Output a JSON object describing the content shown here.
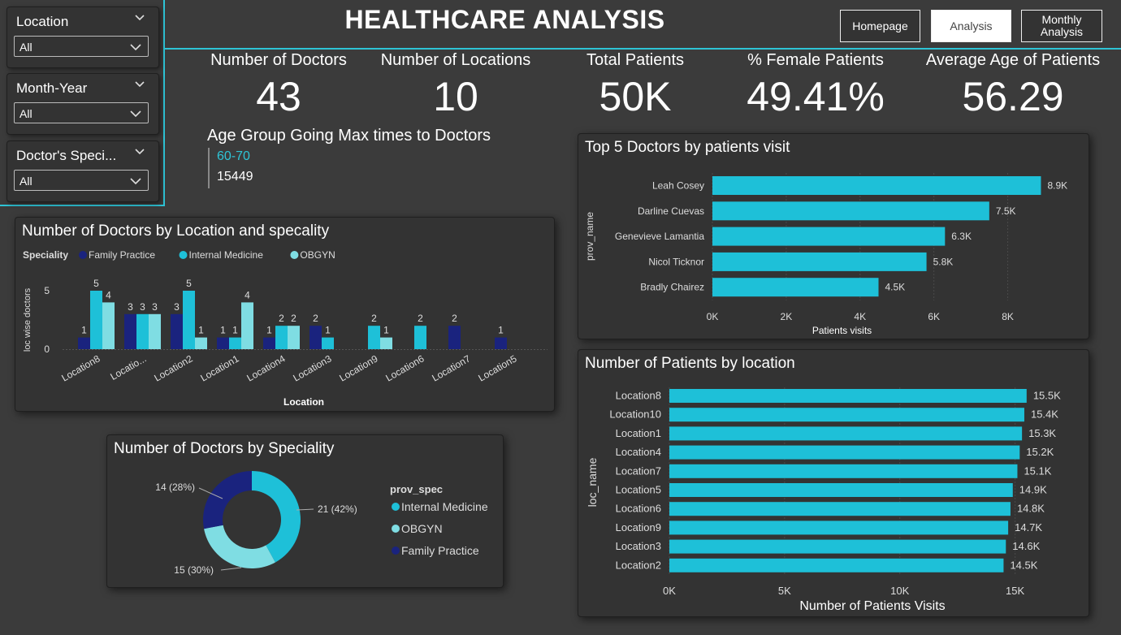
{
  "dashboard_title": "HEALTHCARE ANALYSIS",
  "nav": {
    "homepage": "Homepage",
    "analysis": "Analysis",
    "monthly_line1": "Monthly",
    "monthly_line2": "Analysis"
  },
  "slicers": [
    {
      "title": "Location",
      "value": "All"
    },
    {
      "title": "Month-Year",
      "value": "All"
    },
    {
      "title": "Doctor's Speci...",
      "value": "All"
    }
  ],
  "kpis": [
    {
      "label": "Number of Doctors",
      "value": "43"
    },
    {
      "label": "Number of Locations",
      "value": "10"
    },
    {
      "label": "Total Patients",
      "value": "50K"
    },
    {
      "label": "% Female Patients",
      "value": "49.41%"
    },
    {
      "label": "Average Age of Patients",
      "value": "56.29"
    }
  ],
  "age_group": {
    "title": "Age Group Going Max times to Doctors",
    "category": "60-70",
    "value": "15449"
  },
  "colors": {
    "family_practice": "#1a237e",
    "internal_medicine": "#1ec0d8",
    "obgyn": "#7fdde3",
    "accent": "#2ec4d6"
  },
  "chart_data": [
    {
      "id": "doctors_by_location",
      "type": "bar",
      "title": "Number of Doctors by Location and specality",
      "xlabel": "Location",
      "ylabel": "loc wise doctors",
      "legend_title": "Speciality",
      "legend_position": "top-left",
      "yticks": [
        "0",
        "5"
      ],
      "ylim": [
        0,
        5
      ],
      "categories": [
        "Location8",
        "Locatio...",
        "Location2",
        "Location1",
        "Location4",
        "Location3",
        "Location9",
        "Location6",
        "Location7",
        "Location5"
      ],
      "series": [
        {
          "name": "Family Practice",
          "color": "#1a237e",
          "values": [
            1,
            3,
            3,
            1,
            1,
            2,
            null,
            null,
            2,
            1
          ]
        },
        {
          "name": "Internal Medicine",
          "color": "#1ec0d8",
          "values": [
            5,
            3,
            5,
            1,
            2,
            1,
            2,
            2,
            null,
            null
          ]
        },
        {
          "name": "OBGYN",
          "color": "#7fdde3",
          "values": [
            4,
            3,
            1,
            4,
            2,
            null,
            1,
            null,
            null,
            null
          ]
        }
      ]
    },
    {
      "id": "top5_doctors",
      "type": "bar",
      "orientation": "horizontal",
      "title": "Top 5 Doctors by patients visit",
      "xlabel": "Patients visits",
      "ylabel": "prov_name",
      "xlim": [
        0,
        9000
      ],
      "xticks": [
        "0K",
        "2K",
        "4K",
        "6K",
        "8K"
      ],
      "categories": [
        "Leah Cosey",
        "Darline Cuevas",
        "Genevieve Lamantia",
        "Nicol Ticknor",
        "Bradly Chairez"
      ],
      "values": [
        8900,
        7500,
        6300,
        5800,
        4500
      ],
      "labels": [
        "8.9K",
        "7.5K",
        "6.3K",
        "5.8K",
        "4.5K"
      ],
      "color": "#1ec0d8",
      "grid": true
    },
    {
      "id": "patients_by_location",
      "type": "bar",
      "orientation": "horizontal",
      "title": "Number of Patients by location",
      "xlabel": "Number of Patients Visits",
      "ylabel": "loc_name",
      "xlim": [
        0,
        16000
      ],
      "xticks": [
        "0K",
        "5K",
        "10K",
        "15K"
      ],
      "categories": [
        "Location8",
        "Location10",
        "Location1",
        "Location4",
        "Location7",
        "Location5",
        "Location6",
        "Location9",
        "Location3",
        "Location2"
      ],
      "values": [
        15500,
        15400,
        15300,
        15200,
        15100,
        14900,
        14800,
        14700,
        14600,
        14500
      ],
      "labels": [
        "15.5K",
        "15.4K",
        "15.3K",
        "15.2K",
        "15.1K",
        "14.9K",
        "14.8K",
        "14.7K",
        "14.6K",
        "14.5K"
      ],
      "color": "#1ec0d8",
      "grid": true
    },
    {
      "id": "doctors_by_speciality",
      "type": "pie",
      "donut": true,
      "title": "Number of Doctors by Speciality",
      "legend_title": "prov_spec",
      "legend_position": "right",
      "slices": [
        {
          "name": "Internal Medicine",
          "value": 21,
          "label": "21 (42%)",
          "color": "#1ec0d8"
        },
        {
          "name": "OBGYN",
          "value": 15,
          "label": "15 (30%)",
          "color": "#7fdde3"
        },
        {
          "name": "Family Practice",
          "value": 14,
          "label": "14 (28%)",
          "color": "#1a237e"
        }
      ]
    }
  ]
}
